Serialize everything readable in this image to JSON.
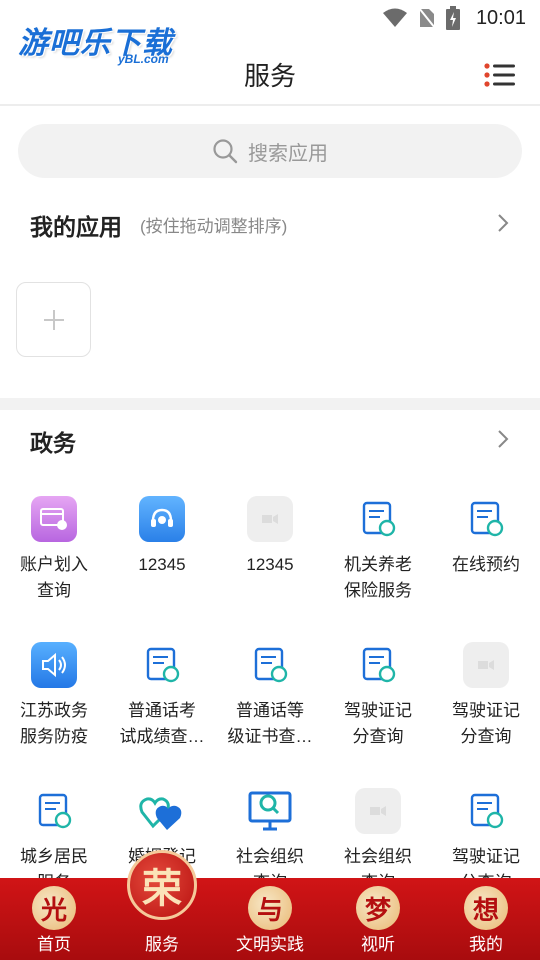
{
  "status": {
    "time": "10:01"
  },
  "logo": {
    "text": "游吧乐下载",
    "sub": "yBL.com"
  },
  "header": {
    "title": "服务"
  },
  "search": {
    "placeholder": "搜索应用"
  },
  "my_apps": {
    "title": "我的应用",
    "hint": "(按住拖动调整排序)"
  },
  "gov": {
    "title": "政务",
    "items": [
      {
        "line1": "账户划入",
        "line2": "查询",
        "icon": "card-icon",
        "color": "#c76ae6"
      },
      {
        "line1": "12345",
        "line2": "",
        "icon": "headset-icon",
        "color": "#3a92ee"
      },
      {
        "line1": "12345",
        "line2": "",
        "icon": "placeholder-icon",
        "color": "#eeeeee"
      },
      {
        "line1": "机关养老",
        "line2": "保险服务",
        "icon": "pension-icon",
        "color": "#1d6fd8"
      },
      {
        "line1": "在线预约",
        "line2": "",
        "icon": "doc-gear-icon",
        "color": "#1d6fd8"
      },
      {
        "line1": "江苏政务",
        "line2": "服务防疫",
        "icon": "speaker-icon",
        "color": "#2f8ff0"
      },
      {
        "line1": "普通话考",
        "line2": "试成绩查…",
        "icon": "exam-icon",
        "color": "#1d6fd8"
      },
      {
        "line1": "普通话等",
        "line2": "级证书查…",
        "icon": "certificate-icon",
        "color": "#1d6fd8"
      },
      {
        "line1": "驾驶证记",
        "line2": "分查询",
        "icon": "license-search-icon",
        "color": "#1d6fd8"
      },
      {
        "line1": "驾驶证记",
        "line2": "分查询",
        "icon": "placeholder-icon",
        "color": "#eeeeee"
      },
      {
        "line1": "城乡居民",
        "line2": "服务",
        "icon": "resident-icon",
        "color": "#1d6fd8"
      },
      {
        "line1": "婚姻登记",
        "line2": "",
        "icon": "hearts-icon",
        "color": "#1fb5a8"
      },
      {
        "line1": "社会组织",
        "line2": "查询",
        "icon": "monitor-search-icon",
        "color": "#1d6fd8"
      },
      {
        "line1": "社会组织",
        "line2": "查询",
        "icon": "placeholder-icon",
        "color": "#eeeeee"
      },
      {
        "line1": "驾驶证记",
        "line2": "分查询",
        "icon": "license-search-icon",
        "color": "#1d6fd8"
      }
    ]
  },
  "nav": [
    {
      "char": "光",
      "label": "首页"
    },
    {
      "char": "荣",
      "label": "服务"
    },
    {
      "char": "与",
      "label": "文明实践"
    },
    {
      "char": "梦",
      "label": "视听"
    },
    {
      "char": "想",
      "label": "我的"
    }
  ],
  "colors": {
    "nav_bg": "#c41214",
    "brand_blue": "#1a6fd6"
  }
}
